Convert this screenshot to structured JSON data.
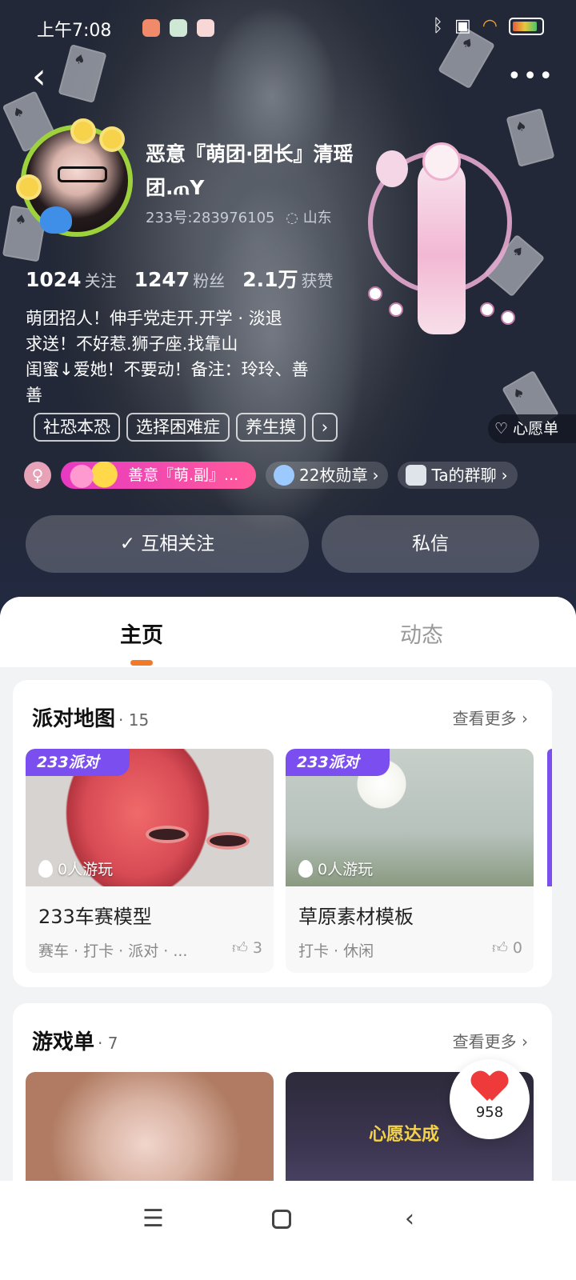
{
  "statusbar": {
    "time": "上午7:08",
    "icons": [
      "bluetooth-icon",
      "sim-icon",
      "wifi-icon",
      "battery-icon"
    ]
  },
  "profile": {
    "nickname": "恶意『萌团·团长』清瑶团.ጠY",
    "id_text": "233号:283976105",
    "location": "山东",
    "stats": [
      {
        "value": "1024",
        "label": "关注"
      },
      {
        "value": "1247",
        "label": "粉丝"
      },
      {
        "value": "2.1万",
        "label": "获赞"
      }
    ],
    "bio": [
      "萌团招人！伸手党走开.开学 · 淡退",
      "求送！不好惹.狮子座.找靠山",
      "闺蜜↓爱她！不要动！备注：玲玲、善",
      "善"
    ],
    "tags": [
      "社恐本恐",
      "选择困难症",
      "养生摸"
    ],
    "tag_more": "›",
    "wish_label": "心愿单",
    "gender_symbol": "♀",
    "group_badge": "善意『萌.副』...",
    "medals": "22枚勋章",
    "group_chat": "Ta的群聊",
    "chevron": "›"
  },
  "actions": {
    "follow": "互相关注",
    "follow_check": "✓",
    "message": "私信"
  },
  "tabs": {
    "home": "主页",
    "feed": "动态"
  },
  "party_section": {
    "title": "派对地图",
    "count": "· 15",
    "more": "查看更多 ›",
    "cards": [
      {
        "brand": "233派对",
        "plays": "0人游玩",
        "name": "233车赛模型",
        "meta": "赛车 · 打卡 · 派对 · ...",
        "likes": "3"
      },
      {
        "brand": "233派对",
        "plays": "0人游玩",
        "name": "草原素材模板",
        "meta": "打卡 · 休闲",
        "likes": "0"
      }
    ]
  },
  "games_section": {
    "title": "游戏单",
    "count": "· 7",
    "more": "查看更多 ›",
    "card2_banner": "心愿达成"
  },
  "heart_fab": {
    "count": "958"
  },
  "sysnav": {
    "menu": "☰",
    "back": "‹"
  },
  "nav": {
    "back": "‹",
    "more": "•••"
  },
  "colors": {
    "accent": "#f07a2a",
    "brand_purple": "#7b4ef0",
    "badge_pink": "#e73ac2",
    "heart": "#ee3a3a"
  }
}
